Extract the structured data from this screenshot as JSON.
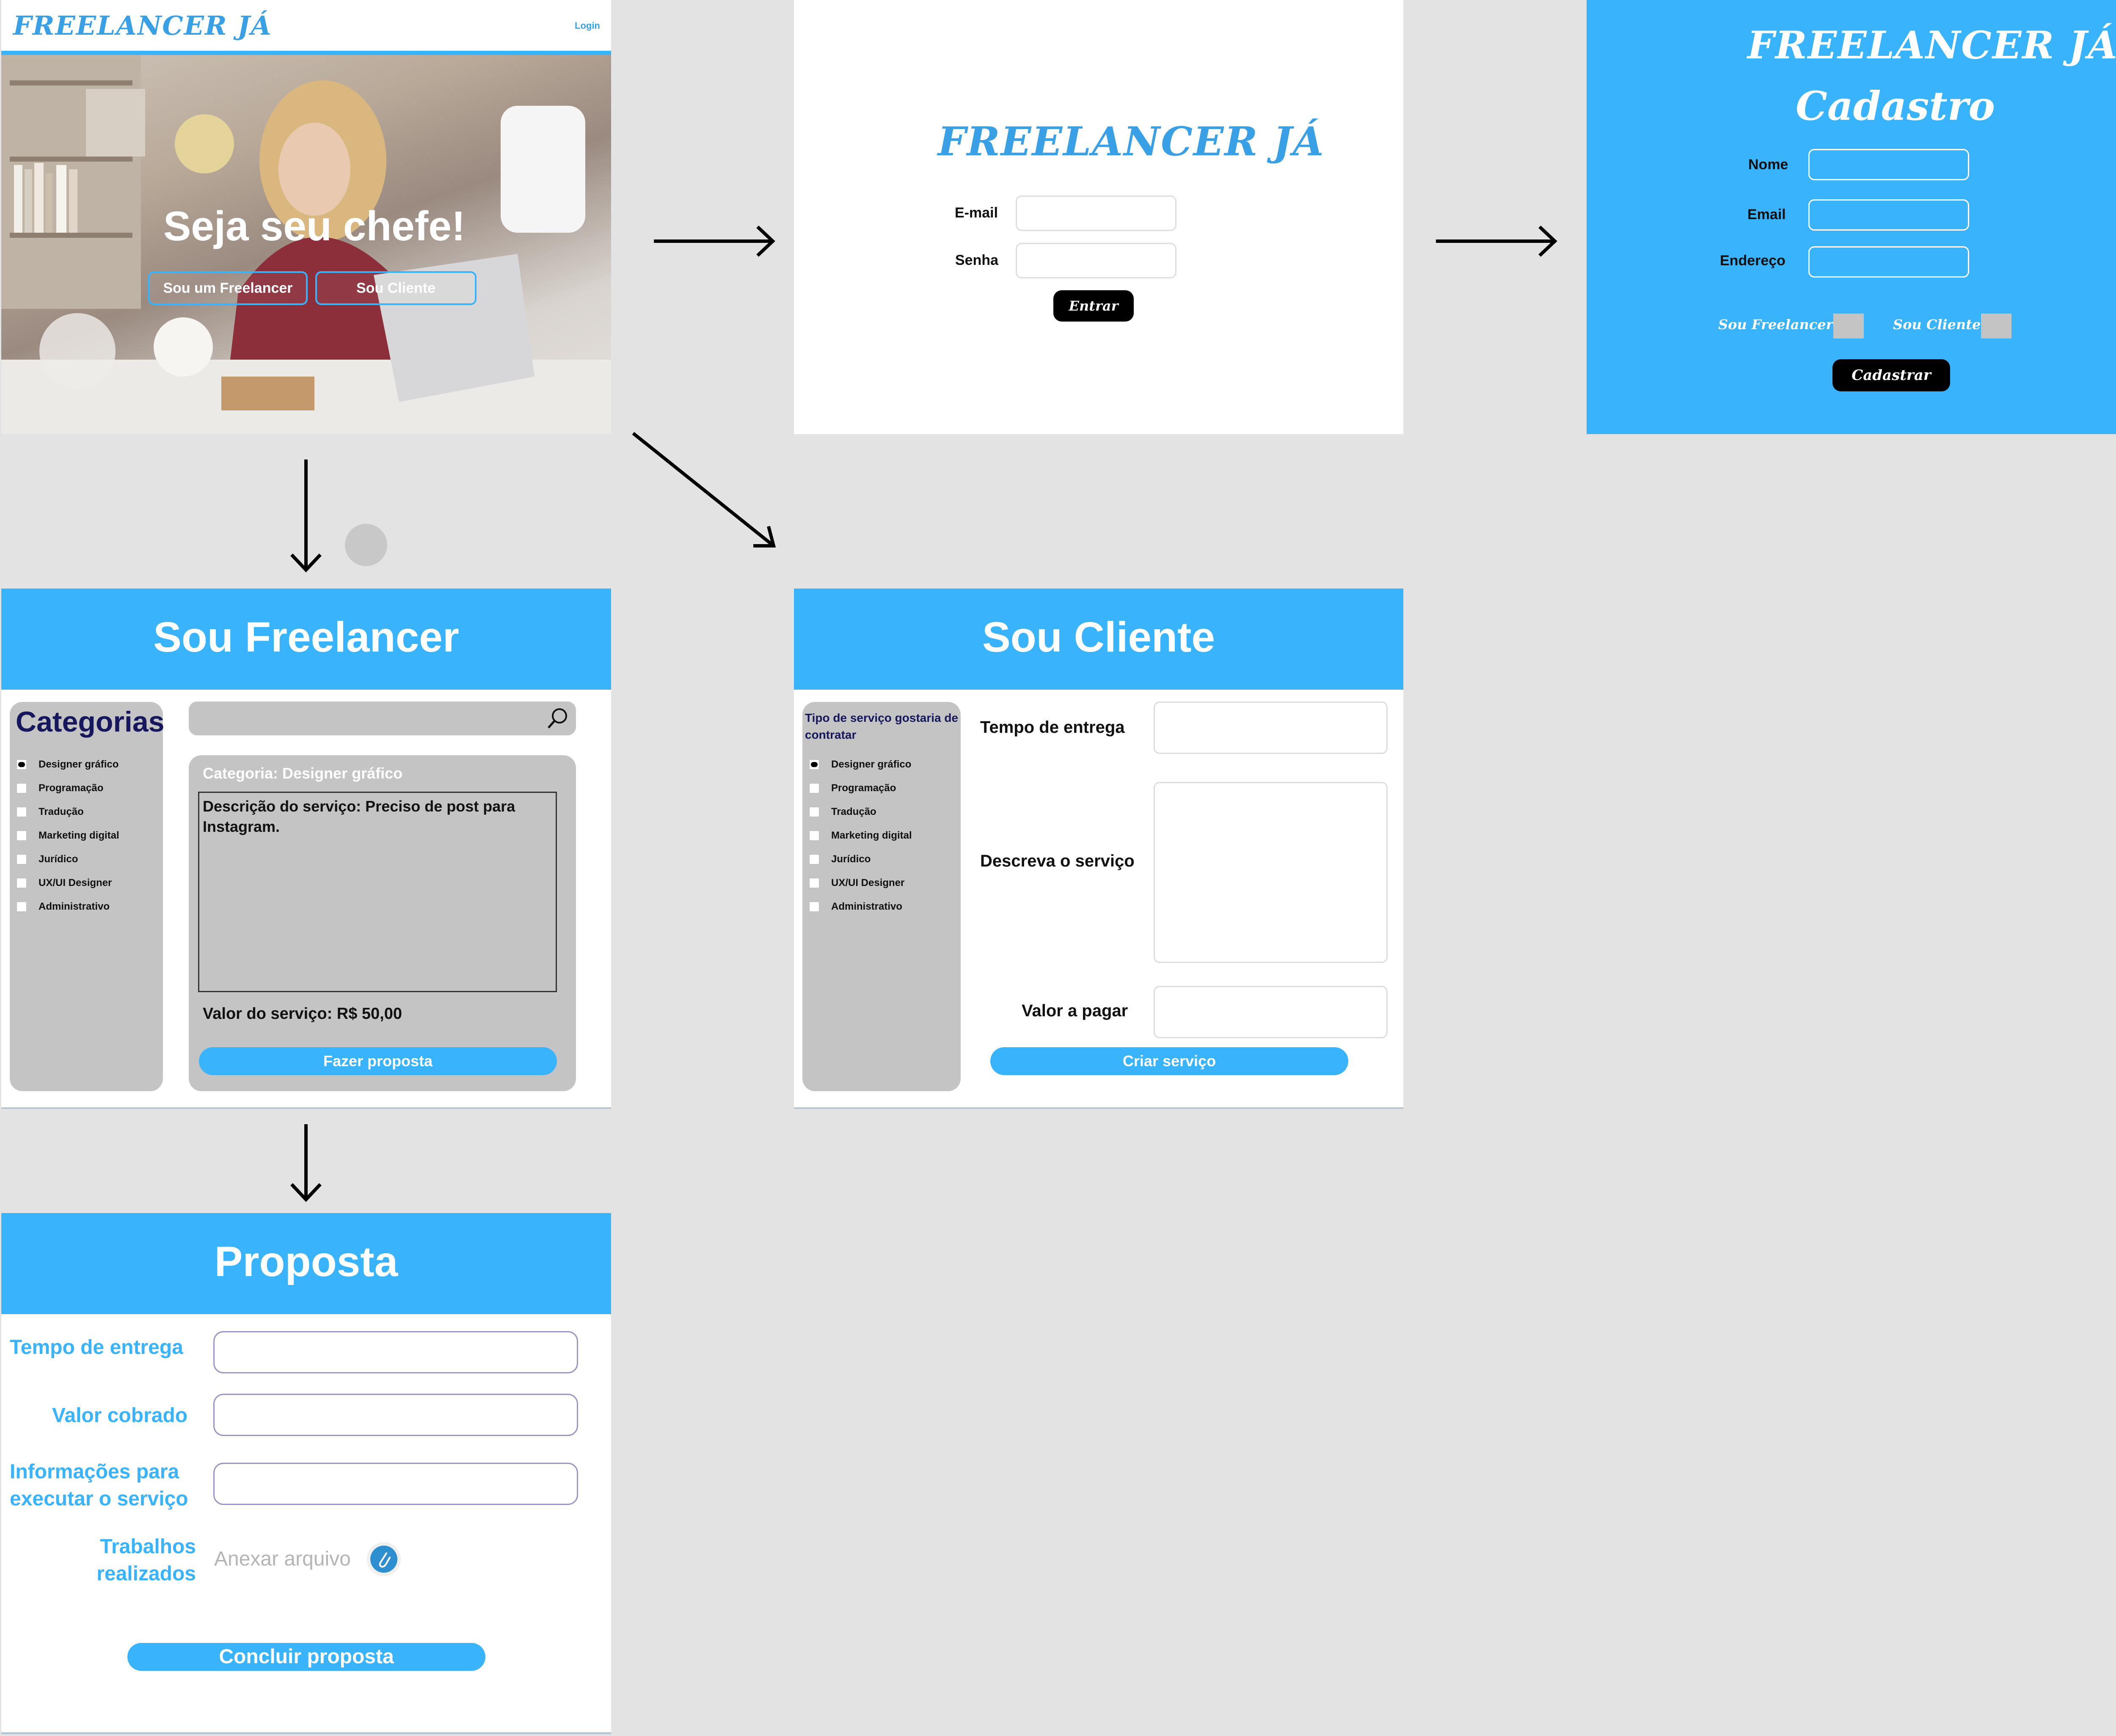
{
  "home": {
    "logo": "FREELANCER JÁ",
    "login_link": "Login",
    "hero_title": "Seja seu chefe!",
    "btn_freelancer": "Sou um Freelancer",
    "btn_cliente": "Sou Cliente"
  },
  "login": {
    "logo": "FREELANCER JÁ",
    "email_label": "E-mail",
    "senha_label": "Senha",
    "enter_button": "Entrar"
  },
  "cadastro": {
    "logo": "FREELANCER JÁ",
    "title": "Cadastro",
    "nome_label": "Nome",
    "email_label": "Email",
    "endereco_label": "Endereço",
    "opt_freelancer": "Sou Freelancer",
    "opt_cliente": "Sou Cliente",
    "submit_button": "Cadastrar"
  },
  "freelancer": {
    "header": "Sou Freelancer",
    "categories_title": "Categorias",
    "categories": [
      "Designer gráfico",
      "Programação",
      "Tradução",
      "Marketing digital",
      "Jurídico",
      "UX/UI Designer",
      "Administrativo"
    ],
    "card_category": "Categoria: Designer gráfico",
    "card_description": "Descrição do serviço: Preciso de post para Instagram.",
    "card_value": "Valor do serviço: R$ 50,00",
    "proposal_button": "Fazer proposta"
  },
  "cliente": {
    "header": "Sou Cliente",
    "sidebar_title": "Tipo de serviço gostaria de contratar",
    "categories": [
      "Designer gráfico",
      "Programação",
      "Tradução",
      "Marketing digital",
      "Jurídico",
      "UX/UI Designer",
      "Administrativo"
    ],
    "tempo_label": "Tempo de entrega",
    "descreva_label": "Descreva o serviço",
    "valor_label": "Valor a pagar",
    "create_button": "Criar serviço"
  },
  "proposta": {
    "header": "Proposta",
    "tempo_label": "Tempo de entrega",
    "valor_label": "Valor cobrado",
    "info_label_1": "Informações para",
    "info_label_2": "executar o serviço",
    "trabalhos_label_1": "Trabalhos",
    "trabalhos_label_2": "realizados",
    "attach_placeholder": "Anexar arquivo",
    "submit_button": "Concluir proposta"
  }
}
